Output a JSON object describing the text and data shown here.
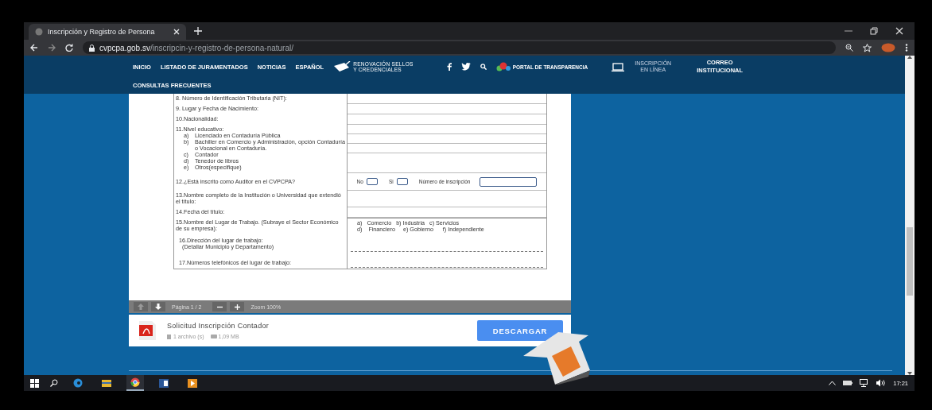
{
  "browser": {
    "tab": {
      "title": "Inscripción y Registro de Persona",
      "selected": true
    },
    "url": {
      "domain": "cvpcpa.gob.sv",
      "path": "/inscripcin-y-registro-de-persona-natural/"
    }
  },
  "nav": {
    "links": [
      "INICIO",
      "LISTADO DE JURAMENTADOS",
      "NOTICIAS",
      "ESPAÑOL"
    ],
    "renovacion": [
      "RENOVACIÓN SELLOS",
      "Y CREDENCIALES"
    ],
    "portal": "PORTAL DE TRANSPARENCIA",
    "inscripcion": [
      "INSCRIPCIÓN",
      "EN LÍNEA"
    ],
    "correo": [
      "CORREO",
      "INSTITUCIONAL"
    ],
    "second_row": [
      "CONSULTAS FRECUENTES"
    ]
  },
  "form": {
    "rows": [
      {
        "kind": "plain",
        "label": "8.  Número de Identificación Tributaria (NIT):"
      },
      {
        "kind": "plain",
        "label": "9.  Lugar y Fecha de Nacimiento:"
      },
      {
        "kind": "plain",
        "label": "10.Nacionalidad:"
      },
      {
        "kind": "list",
        "label": "11.Nivel educativo:",
        "items": [
          {
            "mark": "a)",
            "text": "Licenciado en Contaduría Pública"
          },
          {
            "mark": "b)",
            "text": "Bachiller en Comercio y Administración, opción Contaduría o Vocacional en Contaduría."
          },
          {
            "mark": "c)",
            "text": "Contador"
          },
          {
            "mark": "d)",
            "text": "Tenedor de libros"
          },
          {
            "mark": "e)",
            "text": "Otros(especifique)"
          }
        ]
      },
      {
        "kind": "choice",
        "label": "12.¿Está inscrito como Auditor en el CVPCPA?",
        "options": [
          {
            "label": "No",
            "checked": false
          },
          {
            "label": "Si",
            "checked": false
          }
        ],
        "field_label": "Número de inscripción"
      },
      {
        "kind": "plain",
        "label": "13.Nombre completo de la Institución o Universidad que extendió el título:"
      },
      {
        "kind": "plain",
        "label": "14.Fecha del título:"
      },
      {
        "kind": "sectors",
        "label": "15.Nombre del Lugar de Trabajo. (Subraye el Sector Económico de su empresa):",
        "lines": [
          "a)   Comercio   b) Industria   c) Servicios",
          "d)    Financiero     e) Gobierno      f) Independiente"
        ]
      },
      {
        "kind": "dashed",
        "label": "16.Dirección del lugar de trabajo:",
        "sublabel": "(Detallar Municipio y Departamento)"
      },
      {
        "kind": "dashed",
        "label": "17.Números telefónicos del lugar de trabajo:"
      }
    ]
  },
  "viewer": {
    "page": "Página 1 / 2",
    "zoom": "Zoom 100%"
  },
  "file": {
    "title": "Solicitud Inscripción Contador",
    "count": "1 archivo (s)",
    "size": "1,09 MB",
    "button": "DESCARGAR"
  },
  "taskbar": {
    "apps": [
      {
        "kind": "edge",
        "selected": false
      },
      {
        "kind": "explorer",
        "selected": false
      },
      {
        "kind": "chrome",
        "selected": true
      },
      {
        "kind": "word",
        "selected": false
      },
      {
        "kind": "media",
        "selected": false
      }
    ],
    "clock": "17:21"
  }
}
